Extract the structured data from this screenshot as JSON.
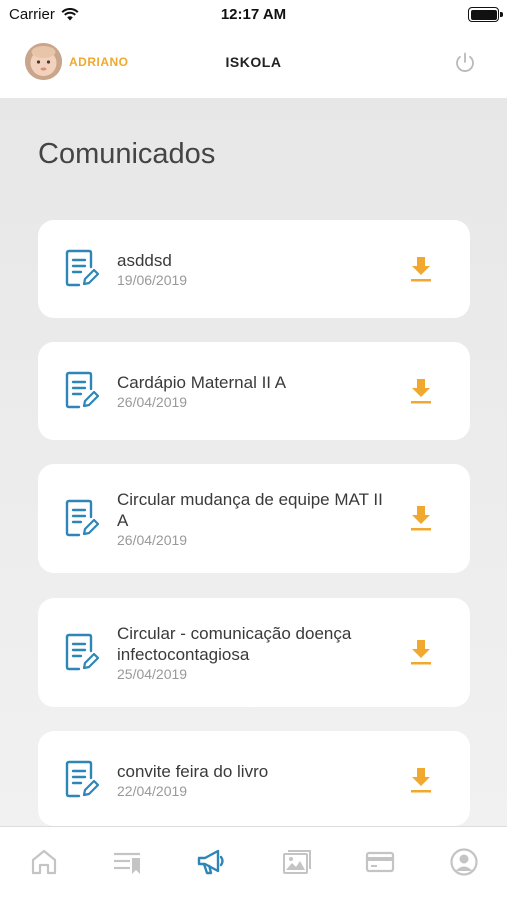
{
  "status": {
    "carrier": "Carrier",
    "time": "12:17 AM",
    "battery_level": 1.0
  },
  "header": {
    "user_name": "ADRIANO",
    "title": "ISKOLA"
  },
  "page": {
    "title": "Comunicados"
  },
  "items": [
    {
      "title": "asddsd",
      "date": "19/06/2019"
    },
    {
      "title": "Cardápio Maternal II A",
      "date": "26/04/2019"
    },
    {
      "title": "Circular mudança de equipe MAT II A",
      "date": "26/04/2019"
    },
    {
      "title": "Circular - comunicação doença infectocontagiosa",
      "date": "25/04/2019"
    },
    {
      "title": "convite feira do livro",
      "date": "22/04/2019"
    }
  ],
  "tabs": [
    {
      "icon": "home-icon",
      "active": false
    },
    {
      "icon": "list-bookmark-icon",
      "active": false
    },
    {
      "icon": "megaphone-icon",
      "active": true
    },
    {
      "icon": "gallery-icon",
      "active": false
    },
    {
      "icon": "card-icon",
      "active": false
    },
    {
      "icon": "profile-icon",
      "active": false
    }
  ],
  "colors": {
    "accent": "#f0a92e",
    "primary_blue": "#2e86b8",
    "inactive": "#c4c4c4"
  }
}
